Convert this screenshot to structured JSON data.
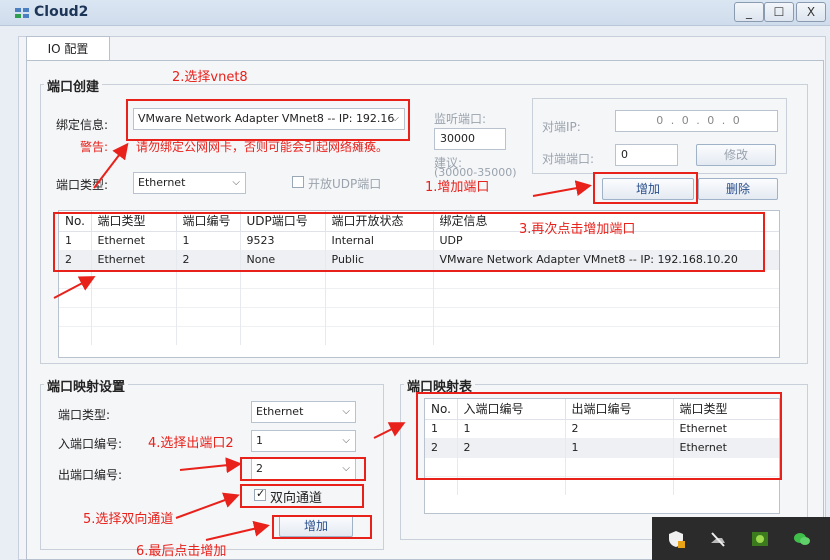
{
  "window": {
    "title": "Cloud2",
    "min": "_",
    "max": "☐",
    "close": "X"
  },
  "tab": {
    "label": "IO 配置"
  },
  "port_create": {
    "title": "端口创建",
    "bind_label": "绑定信息:",
    "bind_value": "VMware Network Adapter VMnet8 -- IP: 192.16",
    "warn_label": "警告:",
    "warn_text": "请勿绑定公网网卡，否则可能会引起网络瘫痪。",
    "port_type_label": "端口类型:",
    "port_type_value": "Ethernet",
    "udp_open_label": "开放UDP端口",
    "listen_label": "监听端口:",
    "listen_value": "30000",
    "suggest_label": "建议:",
    "suggest_value": "(30000-35000)",
    "peer_ip_label": "对端IP:",
    "peer_ip_value": "0 . 0 . 0 . 0",
    "peer_port_label": "对端端口:",
    "peer_port_value": "0",
    "modify_button": "修改",
    "add_button": "增加",
    "delete_button": "删除",
    "table": {
      "headers": [
        "No.",
        "端口类型",
        "端口编号",
        "UDP端口号",
        "端口开放状态",
        "绑定信息"
      ],
      "rows": [
        [
          "1",
          "Ethernet",
          "1",
          "9523",
          "Internal",
          "UDP"
        ],
        [
          "2",
          "Ethernet",
          "2",
          "None",
          "Public",
          "VMware Network Adapter VMnet8 -- IP: 192.168.10.20"
        ]
      ]
    }
  },
  "port_mapping": {
    "title": "端口映射设置",
    "type_label": "端口类型:",
    "type_value": "Ethernet",
    "in_label": "入端口编号:",
    "in_value": "1",
    "out_label": "出端口编号:",
    "out_value": "2",
    "bidirectional_label": "双向通道",
    "add_button": "增加"
  },
  "mapping_table": {
    "title": "端口映射表",
    "headers": [
      "No.",
      "入端口编号",
      "出端口编号",
      "端口类型"
    ],
    "rows": [
      [
        "1",
        "1",
        "2",
        "Ethernet"
      ],
      [
        "2",
        "2",
        "1",
        "Ethernet"
      ]
    ]
  },
  "annotations": {
    "a1": "1.增加端口",
    "a2": "2.选择vnet8",
    "a3": "3.再次点击增加端口",
    "a4": "4.选择出端口2",
    "a5": "5.选择双向通道",
    "a6": "6.最后点击增加"
  },
  "colors": {
    "annotation": "#e8211b",
    "titlebar": "#dbe6f3",
    "tray": "#2b2b2b"
  }
}
